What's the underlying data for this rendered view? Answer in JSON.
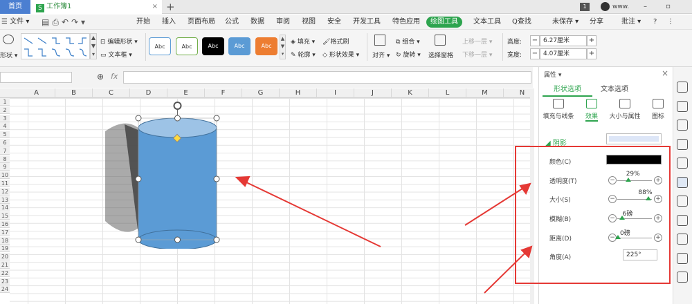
{
  "tabs": {
    "home": "首页",
    "doc": "工作簿1",
    "doc_close": "×",
    "new_tab": "+"
  },
  "titlebar": {
    "badge": "1",
    "user": "www.",
    "controls": "– ▫ ✕"
  },
  "menu": {
    "file": "☰ 文件 ▾",
    "items": [
      "开始",
      "插入",
      "页面布局",
      "公式",
      "数据",
      "审阅",
      "视图",
      "安全",
      "开发工具",
      "特色应用"
    ],
    "active": "绘图工具",
    "text_tool": "文本工具",
    "search": "Q查找",
    "unsaved": "未保存 ▾",
    "share": "分享",
    "annotate": "批注 ▾",
    "help": "?",
    "more": "⋮"
  },
  "ribbon": {
    "shape": "形状 ▾",
    "edit_shape": "编辑形状 ▾",
    "text_box": "文本框 ▾",
    "styles": [
      "Abc",
      "Abc",
      "Abc",
      "Abc",
      "Abc"
    ],
    "fill": "填充 ▾",
    "format_brush": "格式刷",
    "outline": "轮廓 ▾",
    "shape_effect": "形状效果 ▾",
    "align": "对齐 ▾",
    "group": "组合 ▾",
    "rotate": "旋转 ▾",
    "select_pane": "选择窗格",
    "up_layer": "上移一层 ▾",
    "down_layer": "下移一层 ▾",
    "height_label": "高度:",
    "height_value": "6.27厘米",
    "width_label": "宽度:",
    "width_value": "4.07厘米",
    "minus": "−",
    "plus": "+"
  },
  "formula": {
    "fx": "fx",
    "zoom": "⊕"
  },
  "columns": [
    "A",
    "B",
    "C",
    "D",
    "E",
    "F",
    "G",
    "H",
    "I",
    "J",
    "K",
    "L",
    "M",
    "N"
  ],
  "rows": [
    "1",
    "2",
    "3",
    "4",
    "5",
    "6",
    "7",
    "8",
    "9",
    "10",
    "11",
    "12",
    "13",
    "14",
    "15",
    "16",
    "17",
    "18",
    "19",
    "20",
    "21",
    "22",
    "23",
    "24"
  ],
  "panel": {
    "title": "属性 ▾",
    "close": "×",
    "tab_shape": "形状选项",
    "tab_text": "文本选项",
    "subtabs": [
      "填充与线条",
      "效果",
      "大小与属性",
      "图标"
    ],
    "section": "阴影",
    "color_label": "颜色(C)",
    "transparency_label": "透明度(T)",
    "transparency_value": "29%",
    "size_label": "大小(S)",
    "size_value": "88%",
    "blur_label": "模糊(B)",
    "blur_value": "6磅",
    "distance_label": "距离(D)",
    "distance_value": "0磅",
    "angle_label": "角度(A)",
    "angle_value": "225°"
  },
  "colors": {
    "accent": "#2da44e",
    "shape_fill": "#5b9bd5",
    "shape_top": "#9dc3e6",
    "annotation": "#e53935"
  }
}
